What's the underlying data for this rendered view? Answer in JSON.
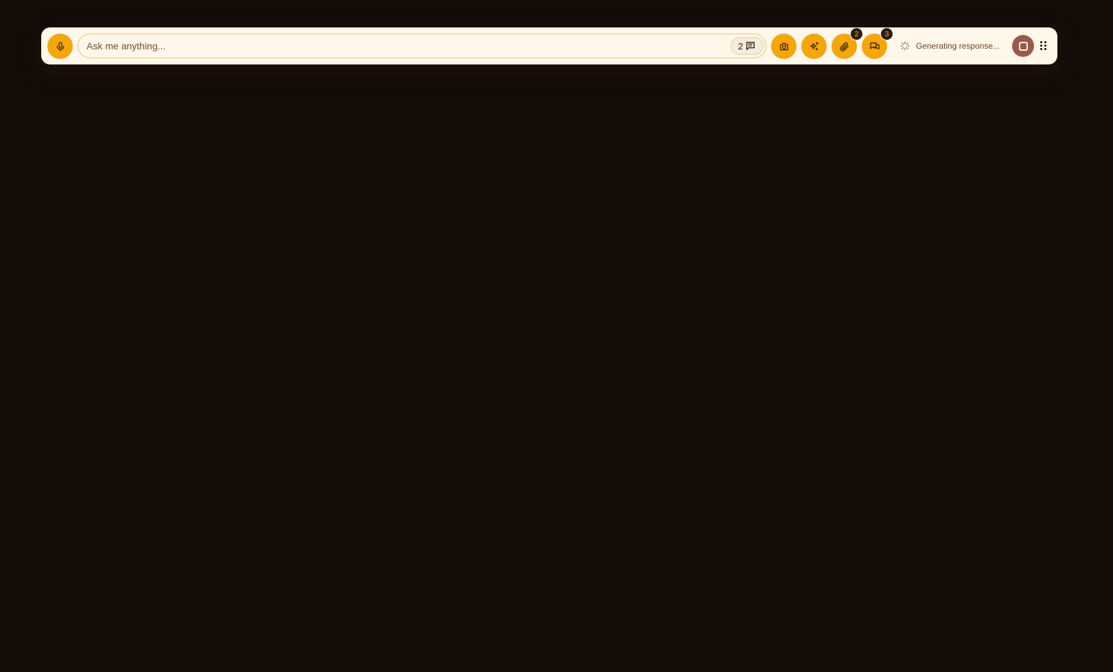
{
  "composer": {
    "placeholder": "Ask me anything...",
    "value": "",
    "message_count": "2"
  },
  "toolbar": {
    "buttons": [
      {
        "name": "microphone",
        "icon": "microphone-icon"
      },
      {
        "name": "camera",
        "icon": "camera-icon"
      },
      {
        "name": "sparkle",
        "icon": "sparkles-icon"
      },
      {
        "name": "attach",
        "icon": "paperclip-icon",
        "badge": "2"
      },
      {
        "name": "chats",
        "icon": "chat-bubbles-icon",
        "badge": "3"
      }
    ]
  },
  "status": {
    "text": "Generating response...",
    "icon": "spinner-icon"
  },
  "stop": {
    "icon": "stop-square-icon"
  },
  "colors": {
    "background": "#120c09",
    "bar": "#fff7ea",
    "accent": "#f5a60b",
    "stop": "#9a5a48",
    "badge": "#2c1c12"
  }
}
